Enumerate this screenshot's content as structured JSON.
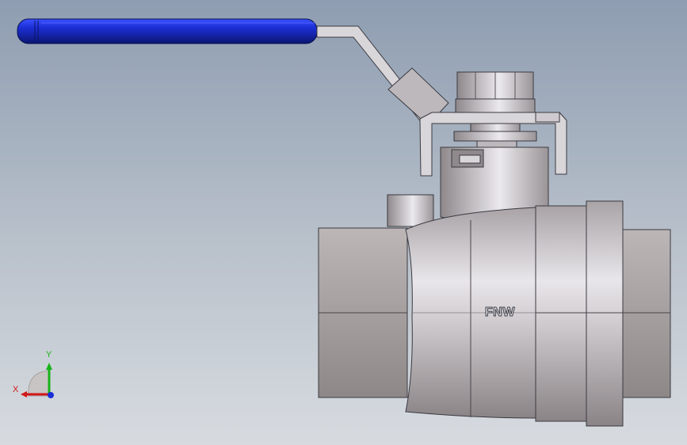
{
  "body_stamp": "FNW",
  "axes": {
    "x_label": "X",
    "y_label": "Y"
  },
  "colors": {
    "background_top": "#8e9db1",
    "background_bottom": "#d7dbe0",
    "handle_grip": "#1c2fd6",
    "metal_light": "#e8e6ea",
    "metal_mid": "#b8b2b4",
    "metal_dark": "#7f797c",
    "axis_x": "#d11919",
    "axis_y": "#18b318",
    "axis_z": "#1b2fd8"
  }
}
